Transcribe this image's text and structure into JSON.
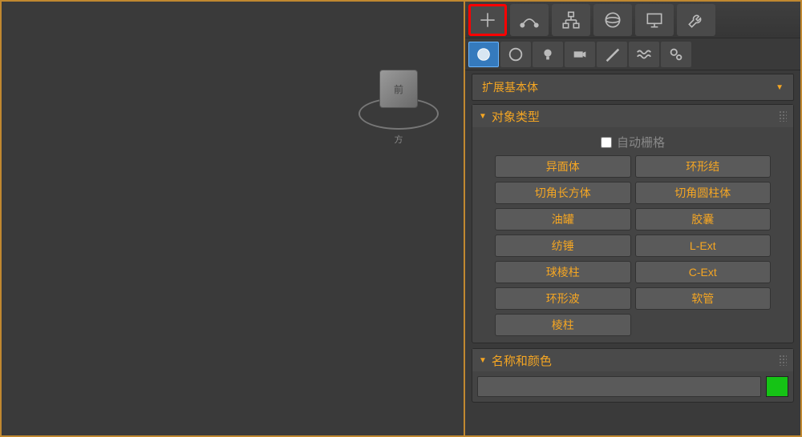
{
  "viewport": {
    "cube_face": "前",
    "cube_below": "方"
  },
  "top_tabs": [
    {
      "name": "create",
      "icon": "plus"
    },
    {
      "name": "modify",
      "icon": "arc"
    },
    {
      "name": "hierarchy",
      "icon": "hierarchy"
    },
    {
      "name": "motion",
      "icon": "sphere"
    },
    {
      "name": "display",
      "icon": "monitor"
    },
    {
      "name": "utilities",
      "icon": "wrench"
    }
  ],
  "category_icons": [
    {
      "name": "geometry",
      "active": true
    },
    {
      "name": "shapes",
      "active": false
    },
    {
      "name": "lights",
      "active": false
    },
    {
      "name": "cameras",
      "active": false
    },
    {
      "name": "helpers",
      "active": false
    },
    {
      "name": "spacewarps",
      "active": false
    },
    {
      "name": "systems",
      "active": false
    }
  ],
  "dropdown": {
    "label": "扩展基本体"
  },
  "rollup_object_type": {
    "title": "对象类型",
    "autogrid_label": "自动栅格",
    "autogrid_checked": false,
    "buttons": [
      "异面体",
      "环形结",
      "切角长方体",
      "切角圆柱体",
      "油罐",
      "胶囊",
      "纺锤",
      "L-Ext",
      "球棱柱",
      "C-Ext",
      "环形波",
      "软管",
      "棱柱",
      ""
    ]
  },
  "rollup_name_color": {
    "title": "名称和颜色",
    "name_value": "",
    "color": "#15c315"
  }
}
